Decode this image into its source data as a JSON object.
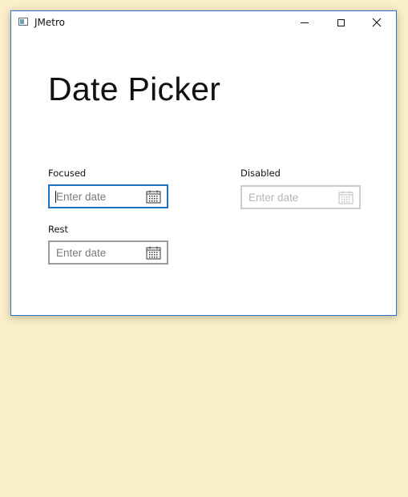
{
  "window": {
    "title": "JMetro",
    "accent_color": "#2b74c9"
  },
  "page": {
    "title": "Date Picker"
  },
  "pickers": {
    "focused": {
      "label": "Focused",
      "placeholder": "Enter date",
      "value": ""
    },
    "disabled": {
      "label": "Disabled",
      "placeholder": "Enter date",
      "value": ""
    },
    "rest": {
      "label": "Rest",
      "placeholder": "Enter date",
      "value": ""
    }
  },
  "icons": {
    "app": "app-window-icon",
    "minimize": "minimize-icon",
    "maximize": "maximize-icon",
    "close": "close-icon",
    "calendar": "calendar-icon"
  },
  "colors": {
    "background": "#fbefca",
    "focus_border": "#1e72c4",
    "rest_border": "#9a9a9a",
    "disabled_border": "#cccccc"
  }
}
